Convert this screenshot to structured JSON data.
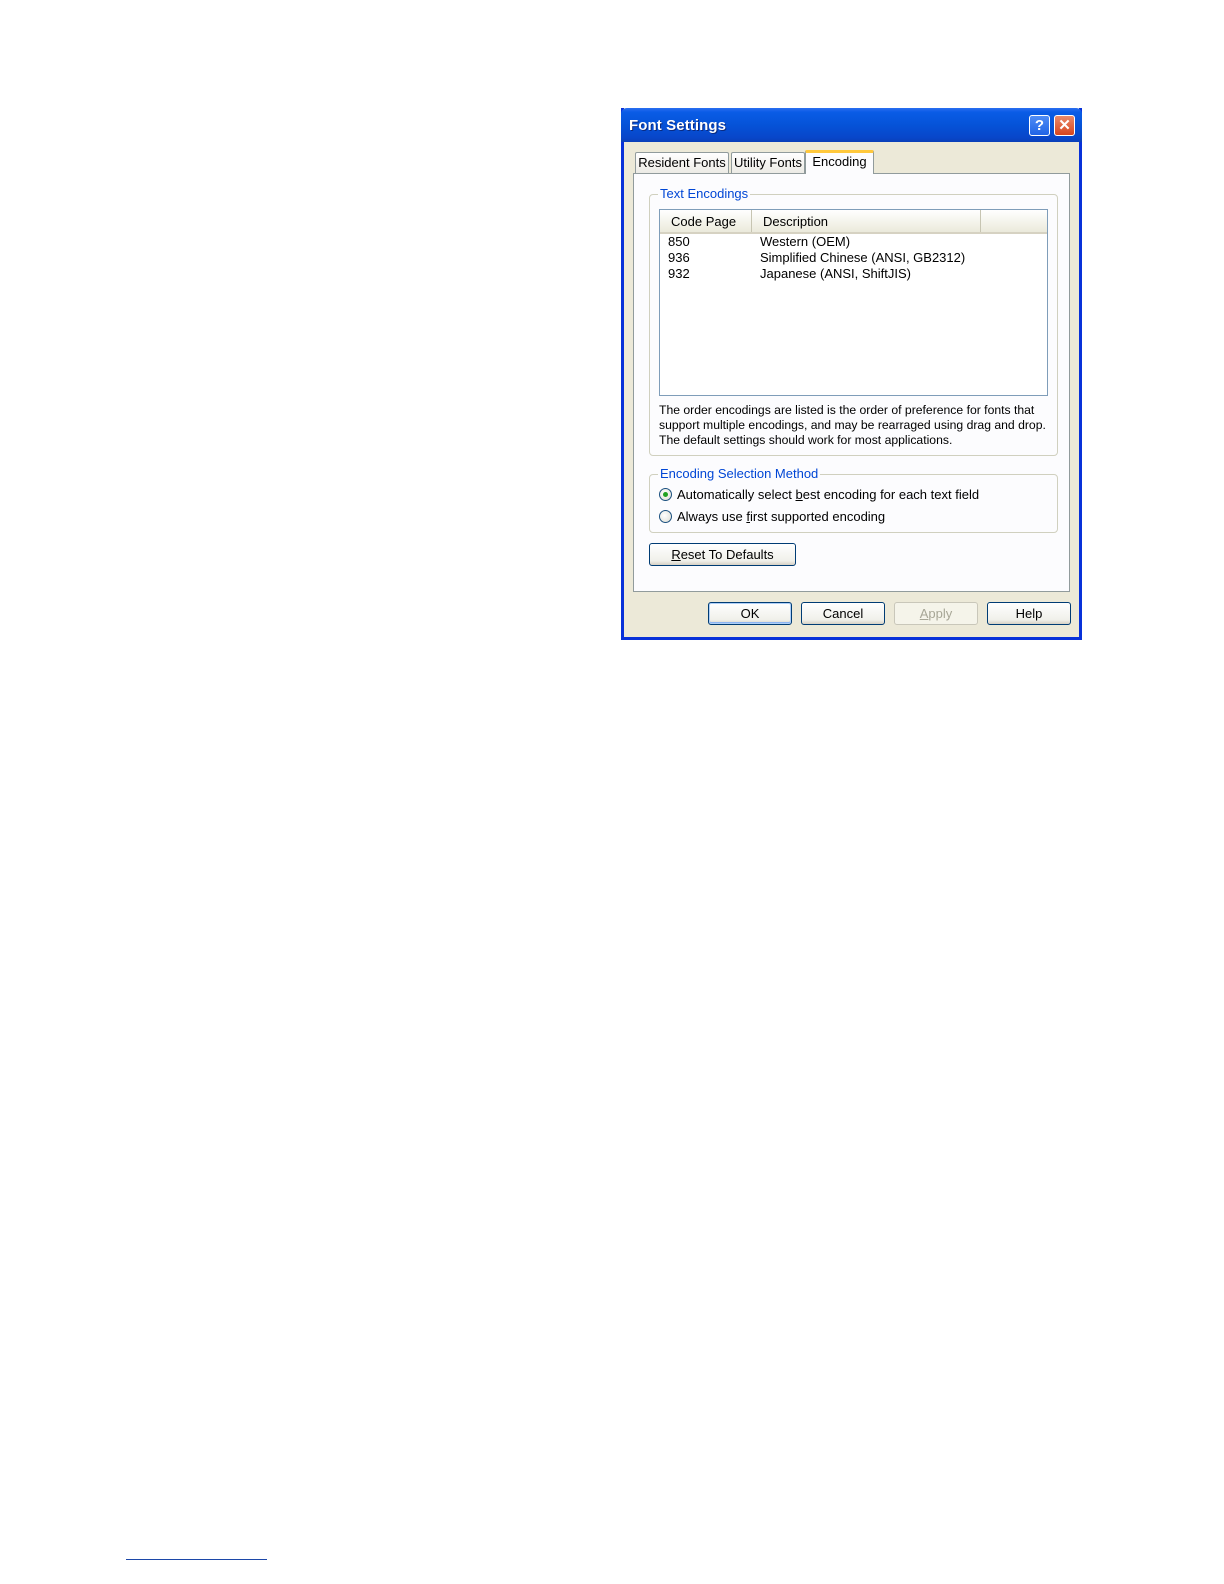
{
  "dialog": {
    "title": "Font Settings",
    "help_glyph": "?",
    "close_glyph": "✕"
  },
  "tabs": [
    {
      "label": "Resident Fonts",
      "active": false
    },
    {
      "label": "Utility Fonts",
      "active": false
    },
    {
      "label": "Encoding",
      "active": true
    }
  ],
  "text_encodings": {
    "label": "Text Encodings",
    "columns": [
      "Code Page",
      "Description"
    ],
    "rows": [
      {
        "code_page": "850",
        "description": "Western (OEM)"
      },
      {
        "code_page": "936",
        "description": "Simplified Chinese (ANSI, GB2312)"
      },
      {
        "code_page": "932",
        "description": "Japanese (ANSI, ShiftJIS)"
      }
    ],
    "description_lines": [
      "The order encodings are listed is the order of preference for fonts that",
      "support multiple encodings, and may be rearraged using drag and drop.",
      "The default settings should work for most applications."
    ]
  },
  "encoding_selection": {
    "label": "Encoding Selection Method",
    "options": [
      {
        "before": "Automatically select ",
        "mnemonic": "b",
        "after": "est encoding for each text field",
        "selected": true
      },
      {
        "before": "Always use ",
        "mnemonic": "f",
        "after": "irst supported encoding",
        "selected": false
      }
    ]
  },
  "reset_button": {
    "mnemonic": "R",
    "rest": "eset To Defaults"
  },
  "buttons": {
    "ok": "OK",
    "cancel": "Cancel",
    "apply_mnemonic": "A",
    "apply_rest": "pply",
    "help": "Help"
  }
}
